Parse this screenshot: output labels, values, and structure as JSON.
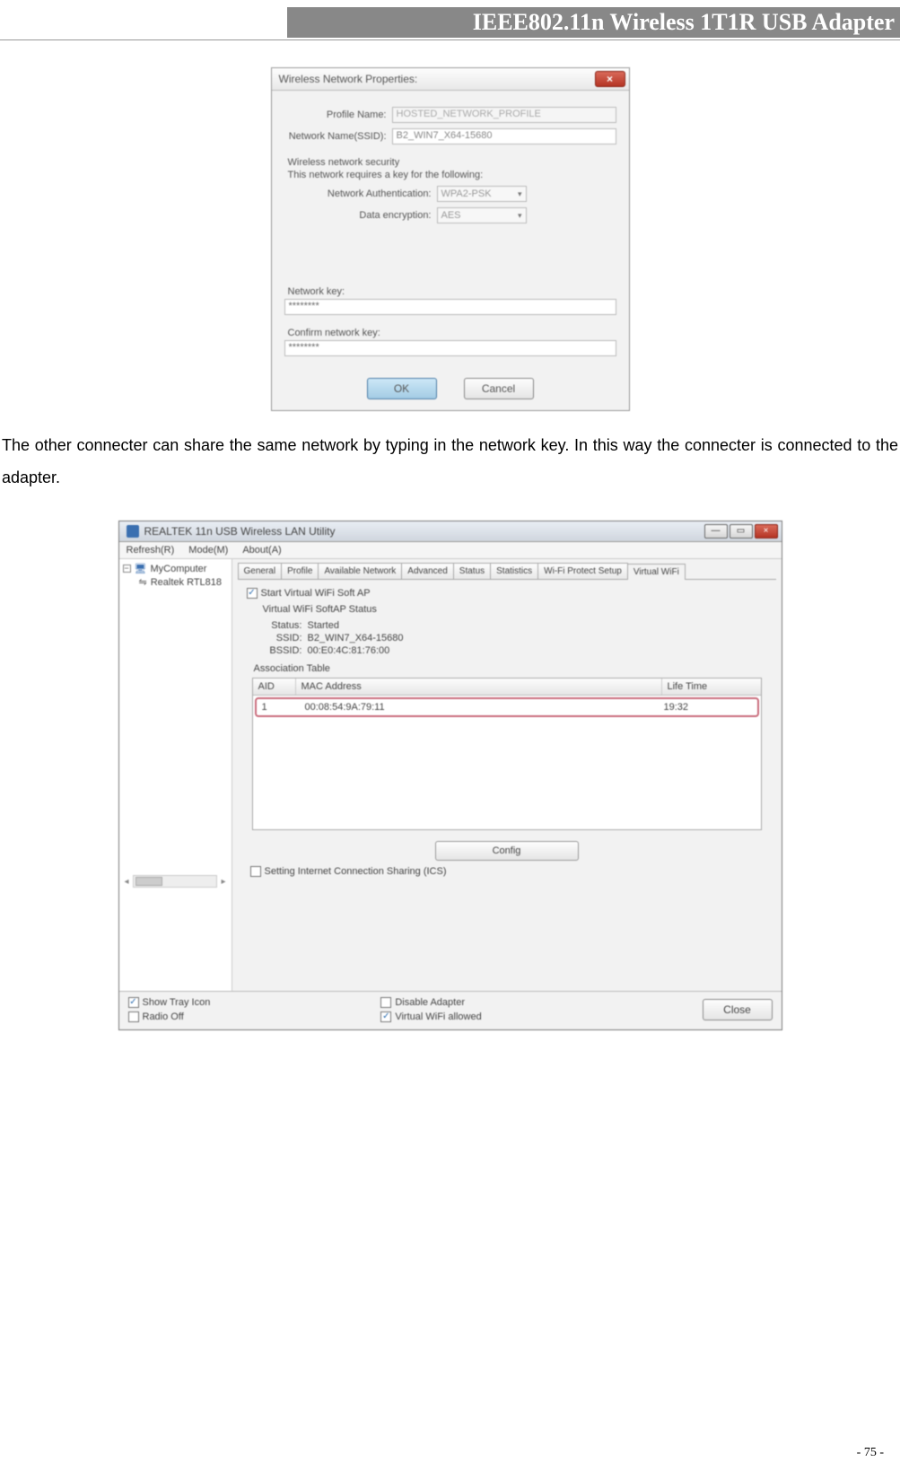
{
  "page": {
    "header_title": "IEEE802.11n Wireless 1T1R USB Adapter",
    "body_text": "The other connecter can share the same network by typing in the network key. In this way the connecter is connected to the adapter.",
    "page_number": "- 75 -"
  },
  "dialog1": {
    "title": "Wireless Network Properties:",
    "close_glyph": "×",
    "profile_name_label": "Profile Name:",
    "profile_name_value": "HOSTED_NETWORK_PROFILE",
    "ssid_label": "Network Name(SSID):",
    "ssid_value": "B2_WIN7_X64-15680",
    "security_group_title": "Wireless network security",
    "security_group_sub": "This network requires a key for the following:",
    "auth_label": "Network Authentication:",
    "auth_value": "WPA2-PSK",
    "enc_label": "Data encryption:",
    "enc_value": "AES",
    "key_label": "Network key:",
    "key_value": "********",
    "confirm_key_label": "Confirm network key:",
    "confirm_key_value": "********",
    "ok_label": "OK",
    "cancel_label": "Cancel"
  },
  "utility": {
    "title": "REALTEK 11n USB Wireless LAN Utility",
    "win_min": "—",
    "win_max": "▭",
    "win_close": "×",
    "menu": {
      "refresh": "Refresh(R)",
      "mode": "Mode(M)",
      "about": "About(A)"
    },
    "tree": {
      "root": "MyComputer",
      "expander": "−",
      "child": "Realtek RTL818"
    },
    "tabs": {
      "general": "General",
      "profile": "Profile",
      "available": "Available Network",
      "advanced": "Advanced",
      "status": "Status",
      "statistics": "Statistics",
      "wps": "Wi-Fi Protect Setup",
      "vwifi": "Virtual WiFi"
    },
    "vwifi": {
      "start_checkbox": "Start Virtual WiFi Soft AP",
      "status_group": "Virtual WiFi SoftAP Status",
      "status_label": "Status:",
      "status_value": "Started",
      "ssid_label": "SSID:",
      "ssid_value": "B2_WIN7_X64-15680",
      "bssid_label": "BSSID:",
      "bssid_value": "00:E0:4C:81:76:00",
      "assoc_title": "Association Table",
      "col_aid": "AID",
      "col_mac": "MAC Address",
      "col_life": "Life Time",
      "row_aid": "1",
      "row_mac": "00:08:54:9A:79:11",
      "row_life": "19:32",
      "config_btn": "Config",
      "ics_checkbox": "Setting Internet Connection Sharing (ICS)"
    },
    "bottom": {
      "show_tray": "Show Tray Icon",
      "radio_off": "Radio Off",
      "disable_adapter": "Disable Adapter",
      "vwifi_allowed": "Virtual WiFi allowed",
      "close": "Close"
    },
    "checkmark": "✓"
  }
}
